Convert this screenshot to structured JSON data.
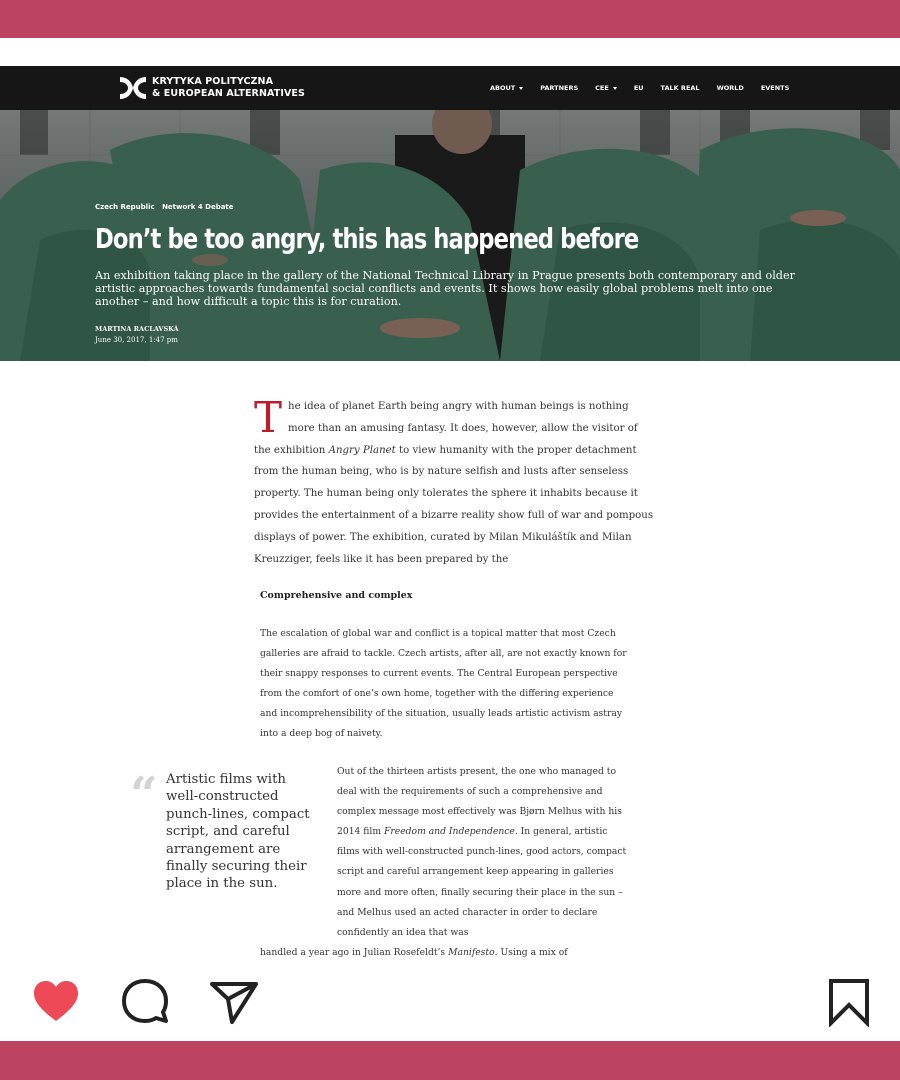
{
  "nav": {
    "logo_line1": "KRYTYKA POLITYCZNA",
    "logo_line2": "& EUROPEAN ALTERNATIVES",
    "items": [
      {
        "label": "ABOUT",
        "dropdown": true
      },
      {
        "label": "PARTNERS",
        "dropdown": false
      },
      {
        "label": "CEE",
        "dropdown": true
      },
      {
        "label": "EU",
        "dropdown": false
      },
      {
        "label": "TALK REAL",
        "dropdown": false
      },
      {
        "label": "WORLD",
        "dropdown": false
      },
      {
        "label": "EVENTS",
        "dropdown": false
      }
    ]
  },
  "hero": {
    "categories": [
      "Czech Republic",
      "Network 4 Debate"
    ],
    "title": "Don’t be too angry, this has happened before",
    "lead": "An exhibition taking place in the gallery of the National Technical Library in Prague presents both contemporary and older artistic approaches towards fundamental social conflicts and events. It shows how easily global problems melt into one another – and how difficult a topic this is for curation.",
    "author": "MARTINA RACLAVSKÁ",
    "date": "June 30, 2017, 1:47 pm"
  },
  "article": {
    "dropcap": "T",
    "intro_a": "he idea of planet Earth being angry with human beings is nothing more than an amusing fantasy. It does, however, allow the visitor of the exhibition ",
    "intro_em": "Angry Planet",
    "intro_b": " to view humanity with the proper detachment from the human being, who is by nature selfish and lusts after senseless property. The human being only tolerates the sphere it inhabits because it provides the entertainment of a bizarre reality show full of war and pompous displays of power. The exhibition, curated by Milan Mikuláštík and Milan Kreuzziger, feels like it has been prepared by the",
    "subheading": "Comprehensive and complex",
    "para1": "The escalation of global war and conflict is a topical matter that most Czech galleries are afraid to tackle. Czech artists, after all, are not exactly known for their snappy responses to current events. The Central European perspective from the comfort of one’s own home, together with the differing experience and incomprehensibility of the situation, usually leads artistic activism astray into a deep bog of naivety.",
    "pull_quote": "Artistic films with well-constructed punch-lines, compact script, and careful arrangement are finally securing their place in the sun.",
    "para2_a": "Out of the thirteen artists present, the one who managed to deal with the requirements of such a comprehensive and complex message most effectively was Bjørn Melhus with his 2014 film ",
    "para2_em": "Freedom and Independence",
    "para2_b": ". In general, artistic films with well-constructed punch-lines, good actors, compact script and careful arrangement keep appearing in galleries more and more often, finally securing their place in the sun – and Melhus used an acted character in order to declare confidently an idea that was",
    "para2_last_a": "handled a year ago in Julian Rosefeldt’s ",
    "para2_last_em": "Manifesto",
    "para2_last_b": ". Using a mix of"
  },
  "actions": {
    "like_icon": "heart-icon",
    "comment_icon": "comment-bubble-icon",
    "share_icon": "paper-plane-icon",
    "save_icon": "bookmark-icon",
    "like_color": "#ed4956",
    "band_color": "#bd4460"
  }
}
